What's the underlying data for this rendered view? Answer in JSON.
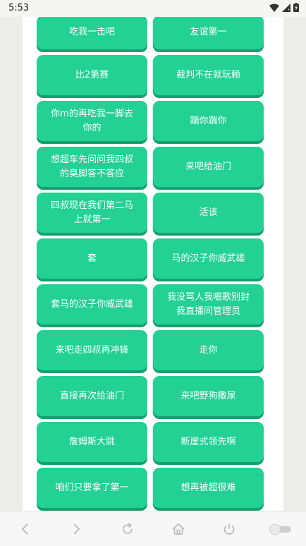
{
  "status_bar": {
    "time": "5:53"
  },
  "buttons": [
    "吃我一击吧",
    "友谊第一",
    "比2第赛",
    "裁判不在就玩赖",
    "你m的再吃我一脚去你的",
    "踹你踹你",
    "想超车先问问我四叔的臭脚答不答应",
    "来吧给油门",
    "四叔现在我们第二马上就第一",
    "活该",
    "套",
    "马的汉子你威武雄",
    "套马的汉子你威武雄",
    "我没骂人我唱歌别封我直播间管理员",
    "来吧走四叔再冲锋",
    "走你",
    "直接再次给油门",
    "来吧野狗撒尿",
    "詹姆斯大跳",
    "断崖式领先啊",
    "咱们只要拿了第一",
    "想再被超很难"
  ],
  "colors": {
    "button": "#22d193",
    "button_shadow": "#16a070",
    "button_text": "#ffffff"
  },
  "nav_icons": [
    "back-icon",
    "forward-icon",
    "reload-icon",
    "home-icon",
    "power-icon",
    "toggle-switch"
  ]
}
